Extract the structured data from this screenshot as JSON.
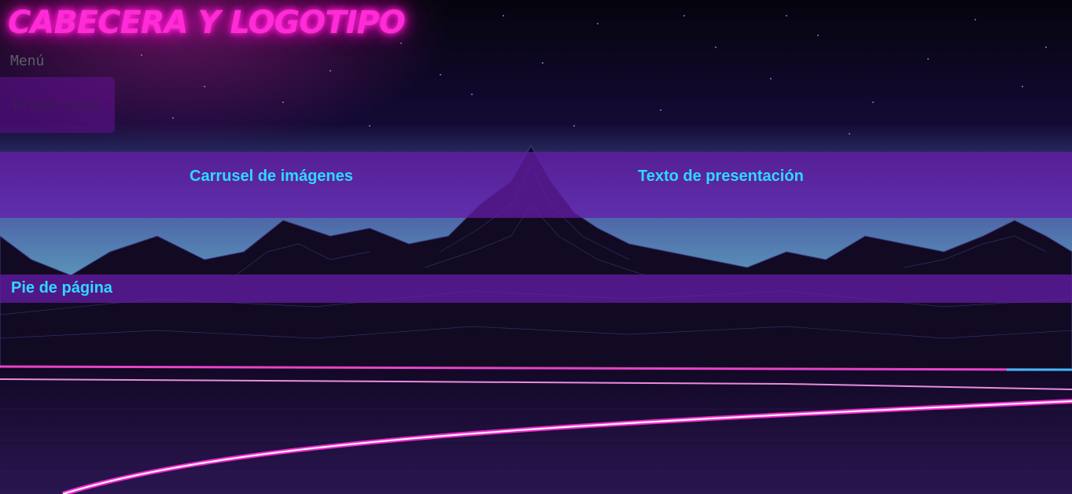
{
  "header": {
    "title": "CABECERA Y LOGOTIPO"
  },
  "nav": {
    "menu_label": "Menú"
  },
  "breadcrumbs": {
    "label": "Breadcrumbs"
  },
  "content": {
    "carousel_label": "Carrusel de imágenes",
    "intro_label": "Texto de presentación"
  },
  "footer": {
    "label": "Pie de página"
  },
  "colors": {
    "neon_pink": "#ff2bd6",
    "cyan_text": "#2fd9ff",
    "band_purple": "#661caa",
    "sky_dark": "#0b0620",
    "sky_light": "#5a93b8"
  }
}
